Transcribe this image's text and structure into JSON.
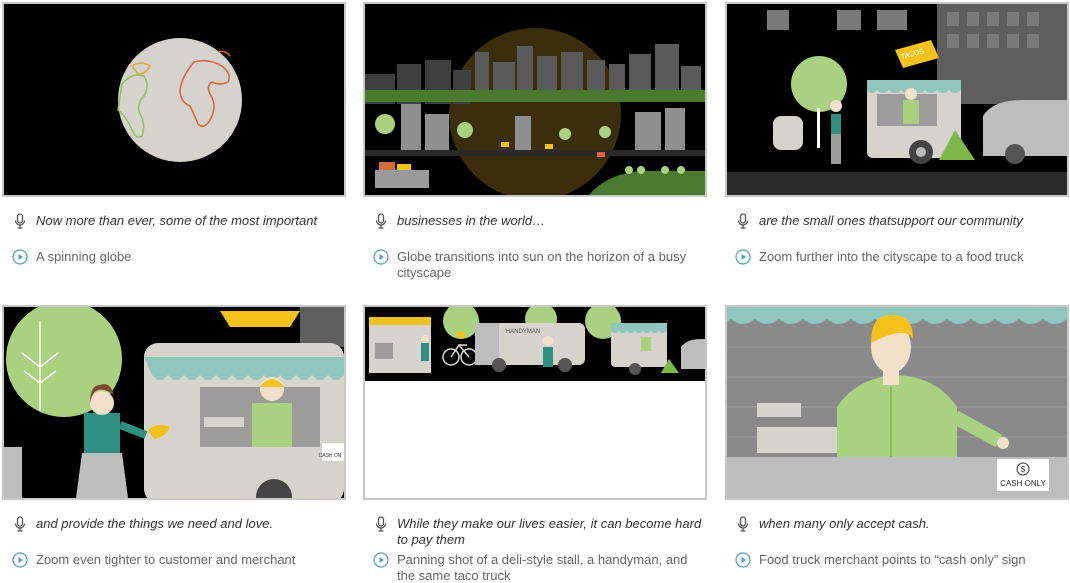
{
  "panels": [
    {
      "voiceover": "Now more than ever, some of the most important",
      "action": "A spinning globe",
      "badge": ""
    },
    {
      "voiceover": "businesses in the world…",
      "action": "Globe transitions into sun on the horizon of a busy cityscape",
      "badge": ""
    },
    {
      "voiceover": "are the small ones thatsupport our community",
      "action": "Zoom further into the cityscape to a food truck",
      "badge": "TACOS"
    },
    {
      "voiceover": "and provide the things we need and love.",
      "action": "Zoom even tighter to customer and merchant",
      "badge": "CASH ON"
    },
    {
      "voiceover": "While they make our lives easier, it can become hard to pay them",
      "action": "Panning shot of a deli-style stall, a handyman, and the same taco truck",
      "badge": "HANDYMAN"
    },
    {
      "voiceover": "when many only accept cash.",
      "action": "Food truck merchant points to “cash only” sign",
      "badge": "CASH ONLY"
    }
  ],
  "icons": {
    "voiceover": "microphone-icon",
    "action": "play-circle-icon"
  },
  "colors": {
    "frame_border": "#c8c8c8",
    "night": "#000000",
    "tree_green": "#a9d17f",
    "teal": "#2f8f83",
    "awning_teal": "#8fc7bf",
    "taco_yellow": "#f5c21b",
    "truck_gray": "#d6d3cc"
  }
}
